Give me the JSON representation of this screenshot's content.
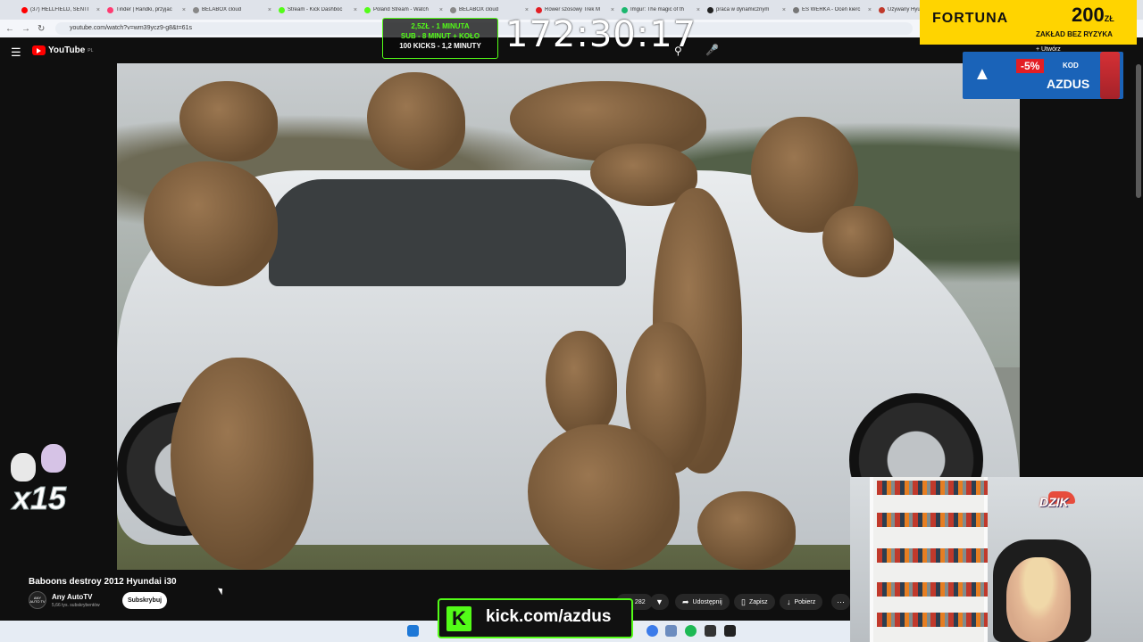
{
  "browser": {
    "tabs": [
      {
        "title": "(37) HELLFIELD, SENTI",
        "color": "#ff0000"
      },
      {
        "title": "Tinder | Randki, przyjac",
        "color": "#fe3c72"
      },
      {
        "title": "BELABOX cloud",
        "color": "#888888"
      },
      {
        "title": "Stream - Kick Dashboc",
        "color": "#53fc18"
      },
      {
        "title": "Poland Stream - Watch",
        "color": "#53fc18"
      },
      {
        "title": "BELABOX cloud",
        "color": "#888888"
      },
      {
        "title": "Rower szosowy Trek M",
        "color": "#e31e24"
      },
      {
        "title": "Imgur: The magic of th",
        "color": "#1bb76e"
      },
      {
        "title": "praca w dynamicznym",
        "color": "#222222"
      },
      {
        "title": "ES WERKA - Oceń kierc",
        "color": "#777777"
      },
      {
        "title": "Używany Hyu",
        "color": "#c0392b"
      }
    ],
    "url": "youtube.com/watch?v=wm39ycz9-g8&t=61s"
  },
  "youtube": {
    "logo_text": "YouTube",
    "region": "PL",
    "create_label": "+ Utwórz",
    "video_title": "Baboons destroy 2012 Hyundai i30",
    "channel_name": "Any AutoTV",
    "channel_avatar": "ANY AUTO TV",
    "subscribers": "5,66 tys. subskrybentów",
    "subscribe_label": "Subskrybuj",
    "like_count": "282",
    "share_label": "Udostępnij",
    "save_label": "Zapisz",
    "download_label": "Pobierz"
  },
  "overlays": {
    "subgoal_line1": "2,5ZŁ - 1 MINUTA",
    "subgoal_line2": "SUB - 8 MINUT + KOŁO",
    "subgoal_line3": "100 KICKS - 1,2 MINUTY",
    "timer": "172:30:17",
    "fortuna_brand": "FORTUNA",
    "fortuna_amount": "200",
    "fortuna_currency": "ZŁ",
    "fortuna_sub": "ZAKŁAD BEZ RYZYKA",
    "discount_pct": "-5%",
    "discount_kod": "KOD",
    "discount_code": "AZDUS",
    "kick_url": "kick.com/azdus",
    "multiplier": "x15",
    "webcam_brand": "DZIK"
  },
  "colors": {
    "kick_green": "#53fc18",
    "youtube_red": "#ff0000",
    "fortuna_yellow": "#ffd400",
    "dzik_blue": "#1a63b8"
  }
}
